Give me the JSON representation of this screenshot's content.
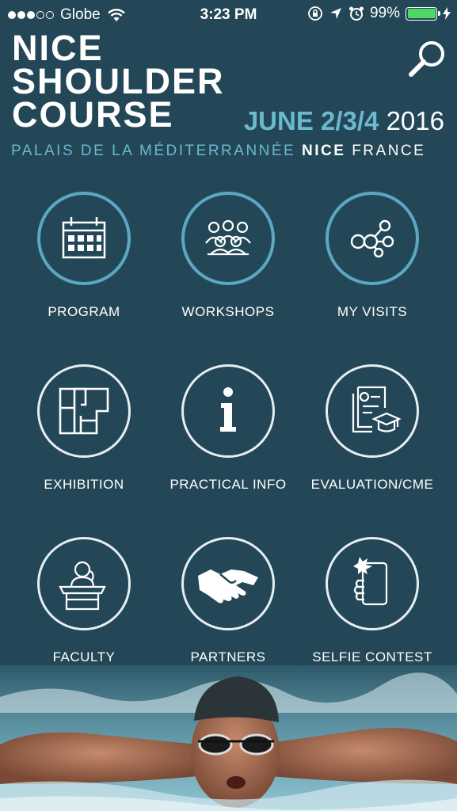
{
  "status": {
    "carrier": "Globe",
    "time": "3:23 PM",
    "battery": "99%"
  },
  "header": {
    "title_lines": [
      "NICE",
      "SHOULDER",
      "COURSE"
    ],
    "dates": "JUNE 2/3/4",
    "year": "2016",
    "venue": "PALAIS DE LA MÉDITERRANNÉE",
    "city": "NICE",
    "country": "FRANCE"
  },
  "menu": [
    {
      "label": "PROGRAM",
      "icon": "calendar-icon"
    },
    {
      "label": "WORKSHOPS",
      "icon": "audience-icon"
    },
    {
      "label": "MY VISITS",
      "icon": "network-icon"
    },
    {
      "label": "EXHIBITION",
      "icon": "floorplan-icon"
    },
    {
      "label": "PRACTICAL INFO",
      "icon": "info-icon"
    },
    {
      "label": "EVALUATION/CME",
      "icon": "certificate-icon"
    },
    {
      "label": "FACULTY",
      "icon": "speaker-podium-icon"
    },
    {
      "label": "PARTNERS",
      "icon": "handshake-icon"
    },
    {
      "label": "SELFIE CONTEST",
      "icon": "selfie-phone-icon"
    }
  ],
  "colors": {
    "background": "#234757",
    "accent": "#6bb8cf",
    "ring": "#5aa8c2"
  }
}
